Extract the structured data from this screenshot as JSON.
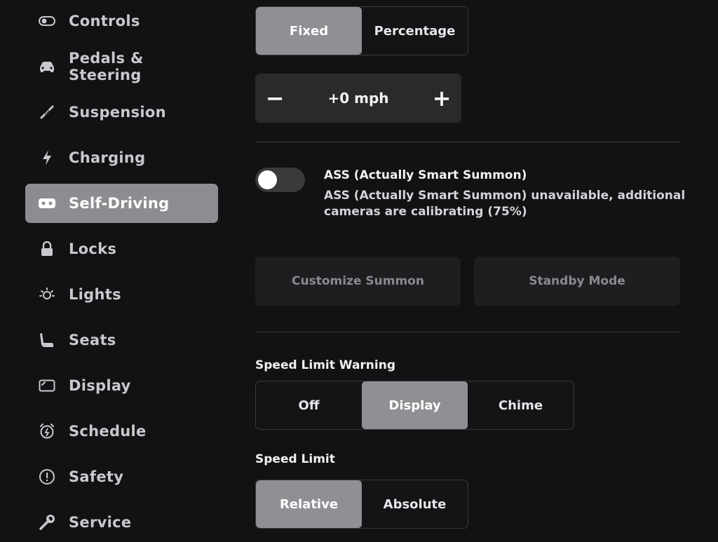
{
  "sidebar": {
    "items": [
      {
        "label": "Controls",
        "icon": "toggle-icon",
        "active": false
      },
      {
        "label": "Pedals & Steering",
        "icon": "car-icon",
        "active": false
      },
      {
        "label": "Suspension",
        "icon": "suspension-icon",
        "active": false
      },
      {
        "label": "Charging",
        "icon": "lightning-icon",
        "active": false
      },
      {
        "label": "Self-Driving",
        "icon": "steering-wheel-icon",
        "active": true
      },
      {
        "label": "Locks",
        "icon": "lock-icon",
        "active": false
      },
      {
        "label": "Lights",
        "icon": "sun-icon",
        "active": false
      },
      {
        "label": "Seats",
        "icon": "seat-icon",
        "active": false
      },
      {
        "label": "Display",
        "icon": "display-icon",
        "active": false
      },
      {
        "label": "Schedule",
        "icon": "alarm-clock-icon",
        "active": false
      },
      {
        "label": "Safety",
        "icon": "alert-icon",
        "active": false
      },
      {
        "label": "Service",
        "icon": "wrench-icon",
        "active": false
      }
    ]
  },
  "offset_mode": {
    "options": [
      "Fixed",
      "Percentage"
    ],
    "selected": "Fixed"
  },
  "offset_stepper": {
    "minus": "−",
    "value": "+0 mph",
    "plus": "+"
  },
  "summon": {
    "title": "ASS (Actually Smart Summon)",
    "description": "ASS (Actually Smart Summon) unavailable, additional cameras are calibrating (75%)",
    "enabled": false,
    "customize_label": "Customize Summon",
    "standby_label": "Standby Mode"
  },
  "speed_limit_warning": {
    "label": "Speed Limit Warning",
    "options": [
      "Off",
      "Display",
      "Chime"
    ],
    "selected": "Display"
  },
  "speed_limit": {
    "label": "Speed Limit",
    "options": [
      "Relative",
      "Absolute"
    ],
    "selected": "Relative"
  },
  "colors": {
    "background": "#121113",
    "active": "#8f8c91",
    "text": "#f2f2f5"
  }
}
